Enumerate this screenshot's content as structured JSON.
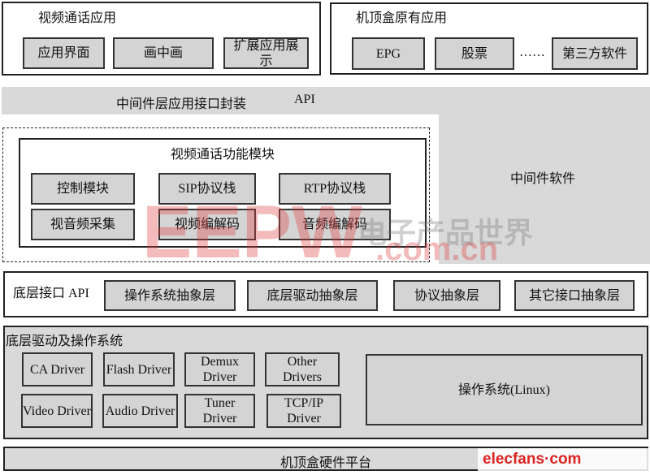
{
  "video_call_apps": {
    "title": "视频通话应用",
    "items": [
      "应用界面",
      "画中画",
      "扩展应用展示"
    ]
  },
  "stb_native_apps": {
    "title": "机顶盒原有应用",
    "items": [
      "EPG",
      "股票",
      "第三方软件"
    ],
    "ellipsis": "……"
  },
  "middleware": {
    "api_label": "中间件层应用接口封装",
    "api": "API",
    "software_label": "中间件软件"
  },
  "video_call_module": {
    "title": "视频通话功能模块",
    "items": [
      "控制模块",
      "SIP协议栈",
      "RTP协议栈",
      "视音频采集",
      "视频编解码",
      "音频编解码"
    ]
  },
  "low_level_api": {
    "title": "底层接口 API",
    "items": [
      "操作系统抽象层",
      "底层驱动抽象层",
      "协议抽象层",
      "其它接口抽象层"
    ]
  },
  "drivers_os": {
    "title": "底层驱动及操作系统",
    "drivers": [
      "CA Driver",
      "Flash Driver",
      "Demux Driver",
      "Other Drivers",
      "Video Driver",
      "Audio Driver",
      "Tuner Driver",
      "TCP/IP Driver"
    ],
    "os": "操作系统(Linux)"
  },
  "hardware": {
    "label": "机顶盒硬件平台"
  },
  "watermarks": {
    "eepw": "EEPW",
    "eepw_cn": "电子产品世界",
    "eepw_domain": ".com.cn",
    "elecfans": "elecfans·com"
  },
  "colors": {
    "box_fill": "#d4d4d4",
    "band_fill": "#d9d9d9",
    "border": "#222222",
    "watermark": "#dc3c3c"
  }
}
